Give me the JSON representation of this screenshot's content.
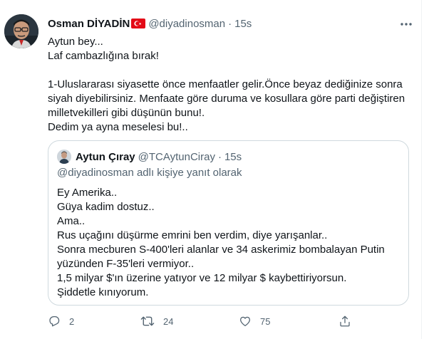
{
  "tweet": {
    "author_name": "Osman DİYADİN",
    "handle": "@diyadinosman",
    "separator": "·",
    "time": "15s",
    "flag": "turkey-flag",
    "text_lines": [
      "Aytun bey...",
      "Laf cambazlığına bırak!",
      "",
      "1-Uluslararası siyasette önce menfaatler gelir.Önce beyaz dediğinize sonra",
      "siyah diyebilirsiniz. Menfaate göre duruma ve kosullara göre parti değiştiren",
      "milletvekilleri gibi düşünün bunu!.",
      "Dedim ya ayna meselesi bu!.."
    ]
  },
  "quote": {
    "author_name": "Aytun Çıray",
    "handle": "@TCAytunCiray",
    "separator": "·",
    "time": "15s",
    "reply_to": "@diyadinosman adlı kişiye yanıt olarak",
    "text_lines": [
      "Ey Amerika..",
      "Güya kadim dostuz..",
      "Ama..",
      "Rus uçağını düşürme emrini ben verdim, diye yarışanlar..",
      "Sonra mecburen S-400'leri alanlar ve 34 askerimiz bombalayan Putin",
      "yüzünden F-35'leri vermiyor..",
      "1,5 milyar $'ın üzerine yatıyor ve 12 milyar $ kaybettiriyorsun.",
      "Şiddetle kınıyorum."
    ]
  },
  "actions": {
    "reply_count": "2",
    "retweet_count": "24",
    "like_count": "75"
  },
  "icons": {
    "more": "more-icon",
    "reply": "reply-icon",
    "retweet": "retweet-icon",
    "like": "like-icon",
    "share": "share-icon"
  },
  "colors": {
    "text": "#0f1419",
    "secondary": "#536471",
    "border": "#cfd9de",
    "flag_red": "#e30a17"
  }
}
